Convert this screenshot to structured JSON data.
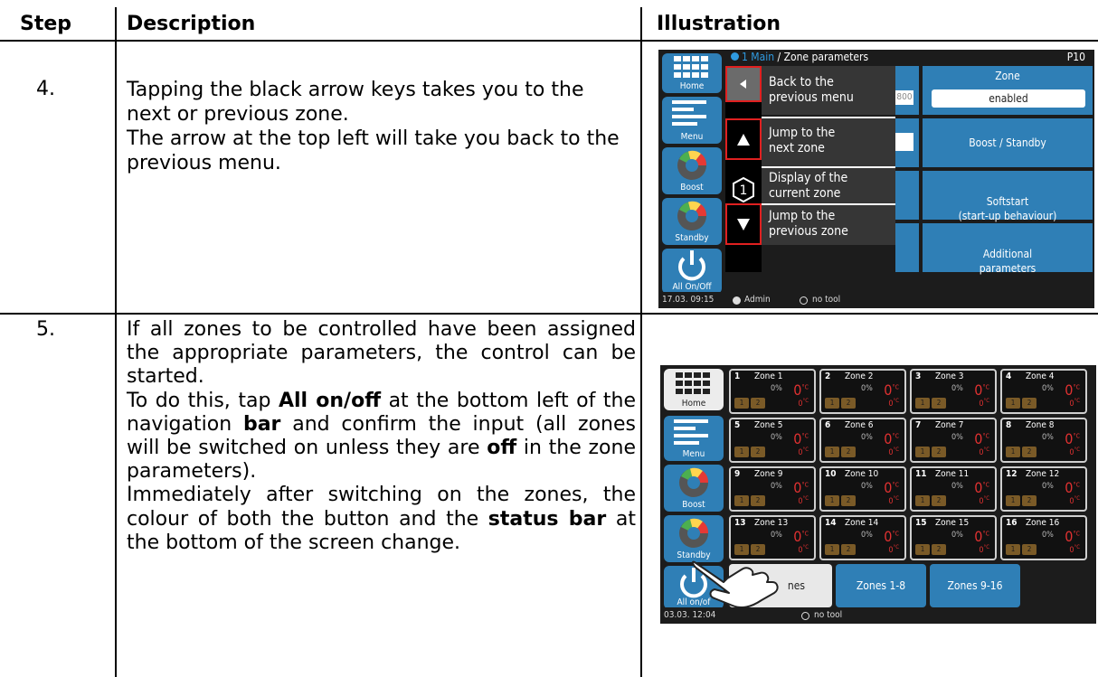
{
  "headers": {
    "step": "Step",
    "description": "Description",
    "illustration": "Illustration"
  },
  "rows": [
    {
      "step": "4.",
      "lines": [
        "Tapping the black arrow keys takes you to the next or previous zone.",
        "The arrow at the top left will take you back to the previous menu."
      ]
    },
    {
      "step": "5.",
      "p1": "If all zones to be controlled have been assigned the appropriate parameters, the control can be started.",
      "p2_a": "To do this, tap ",
      "p2_b": "All on/off",
      "p2_c": " at the bottom left of the navigation ",
      "p2_d": "bar",
      "p2_e": " and confirm the input (all zones will be switched on unless they are ",
      "p2_f": "off",
      "p2_g": " in the zone parameters).",
      "p3_a": "Immediately after switching on the zones, the colour of both the button and the ",
      "p3_b": "status bar",
      "p3_c": " at the bottom of the screen change."
    }
  ],
  "nav": {
    "home": "Home",
    "menu": "Menu",
    "boost": "Boost",
    "standby": "Standby",
    "allonoff": "All On/Off",
    "allonoff2": "All on/of"
  },
  "screen1": {
    "breadcrumb_main": "1 Main",
    "breadcrumb_sep": " / ",
    "breadcrumb_page": "Zone parameters",
    "page_code": "P10",
    "callouts": [
      "Back to the\nprevious menu",
      "Jump to the\nnext zone",
      "Display of the\ncurrent zone",
      "Jump to the\nprevious zone"
    ],
    "partial_value": "800",
    "zone_label": "Zone",
    "zone_value": "enabled",
    "boost_standby": "Boost / Standby",
    "softstart": "Softstart\n(start-up behaviour)",
    "additional": "Additional\nparameters",
    "status_time": "17.03. 09:15",
    "status_user": "Admin",
    "status_tool": "no tool",
    "zone_digit": "1"
  },
  "screen2": {
    "zones": [
      {
        "n": "1",
        "name": "Zone 1"
      },
      {
        "n": "2",
        "name": "Zone 2"
      },
      {
        "n": "3",
        "name": "Zone 3"
      },
      {
        "n": "4",
        "name": "Zone 4"
      },
      {
        "n": "5",
        "name": "Zone 5"
      },
      {
        "n": "6",
        "name": "Zone 6"
      },
      {
        "n": "7",
        "name": "Zone 7"
      },
      {
        "n": "8",
        "name": "Zone 8"
      },
      {
        "n": "9",
        "name": "Zone 9"
      },
      {
        "n": "10",
        "name": "Zone 10"
      },
      {
        "n": "11",
        "name": "Zone 11"
      },
      {
        "n": "12",
        "name": "Zone 12"
      },
      {
        "n": "13",
        "name": "Zone 13"
      },
      {
        "n": "14",
        "name": "Zone 14"
      },
      {
        "n": "15",
        "name": "Zone 15"
      },
      {
        "n": "16",
        "name": "Zone 16"
      }
    ],
    "pct": "0%",
    "temp": "0",
    "unit": "°C",
    "badge1": "1",
    "badge2": "2",
    "all_zones_partial": "nes",
    "zones_1_8": "Zones 1-8",
    "zones_9_16": "Zones 9-16",
    "status_time": "03.03. 12:04",
    "status_tool": "no tool"
  },
  "colors": {
    "accent_blue": "#2f7fb6",
    "callout_red": "#e02020",
    "temp_red": "#e03131"
  }
}
